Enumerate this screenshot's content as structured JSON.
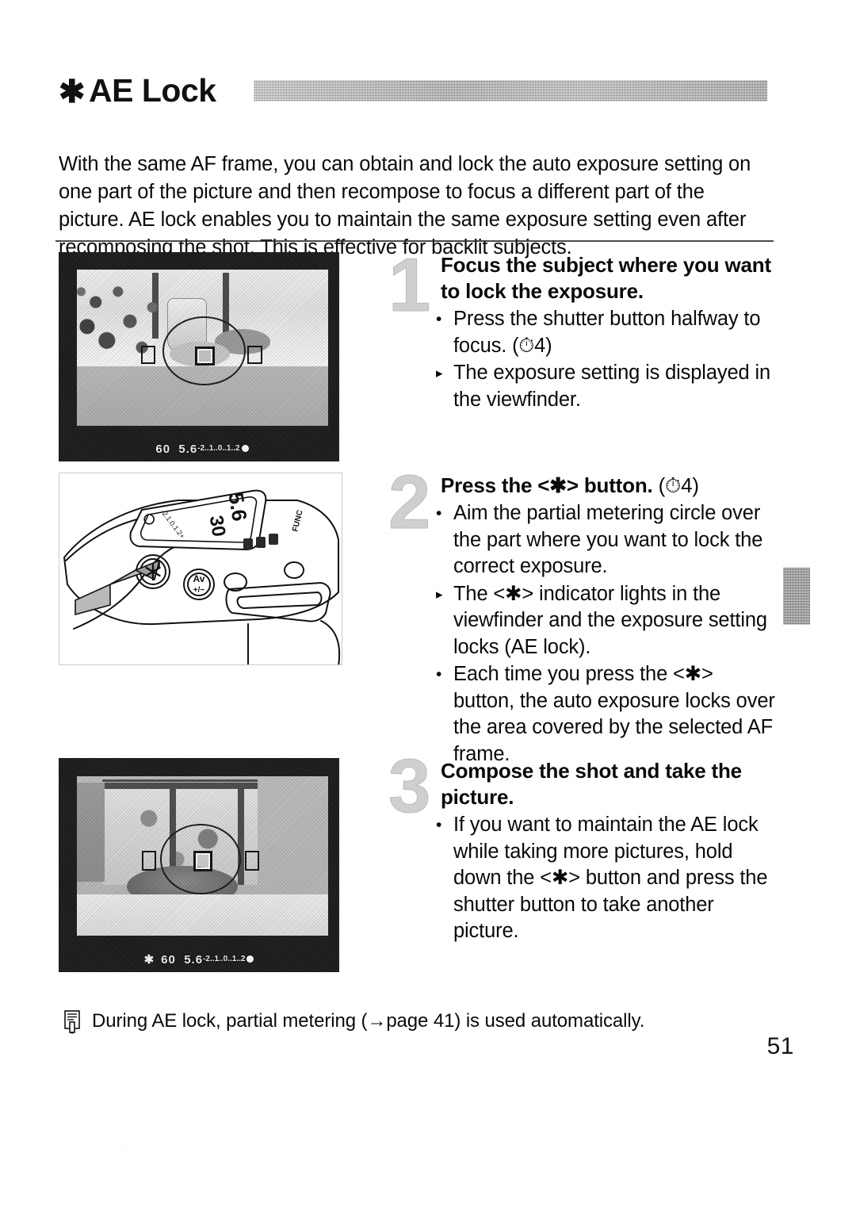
{
  "document": {
    "page_number": "51",
    "section_title": "AE Lock",
    "section_star_glyph": "✱"
  },
  "header": {
    "title": "AE Lock",
    "star": "✱"
  },
  "intro": {
    "text": "With the same AF frame, you can obtain and lock the auto exposure setting on one part of the picture and then recompose to focus a different part of the picture. AE lock enables you to maintain the same exposure setting even after recomposing the shot. This is effective for backlit subjects."
  },
  "steps": [
    {
      "number": "1",
      "heading": "Focus the subject where you want to lock the exposure.",
      "heading_suffix": "",
      "bullets": [
        {
          "mark": "•",
          "text": "Press the shutter button halfway to focus. (⏱4)"
        },
        {
          "mark": "▸",
          "text": "The exposure setting is displayed in the viewfinder."
        }
      ],
      "figure": {
        "name": "viewfinder-photo-focus",
        "type": "photo",
        "caption": "",
        "readout": {
          "star": "",
          "shutter": "60",
          "aperture": "5.6",
          "scale": "-2..1..0..1..2"
        }
      }
    },
    {
      "number": "2",
      "heading": "Press the <✱> button.",
      "heading_suffix": "(⏱4)",
      "bullets": [
        {
          "mark": "•",
          "text": "Aim the partial metering circle over the part where you want to lock the correct exposure."
        },
        {
          "mark": "▸",
          "text": "The <✱> indicator lights in the viewfinder and the exposure setting locks (AE lock)."
        },
        {
          "mark": "•",
          "text": "Each time you press the <✱> button, the auto exposure locks over the area covered by the selected AF frame."
        }
      ],
      "figure": {
        "name": "camera-ae-lock-button-illustration",
        "type": "line-drawing",
        "lcd": {
          "aperture": "5.6",
          "shutter": "30",
          "scale": "-2..1..0..1..2",
          "func_label": "FUNC"
        },
        "buttons": [
          {
            "label": "✱",
            "name": "ae-lock-button"
          },
          {
            "label": "Av +/−",
            "name": "av-exposure-compensation-button"
          }
        ]
      }
    },
    {
      "number": "3",
      "heading": "Compose the shot and take the picture.",
      "heading_suffix": "",
      "bullets": [
        {
          "mark": "•",
          "text": "If you want to maintain the AE lock while taking more pictures, hold down the <✱> button and press the shutter button to take another picture."
        }
      ],
      "figure": {
        "name": "viewfinder-photo-recomposed",
        "type": "photo",
        "caption": "",
        "readout": {
          "star": "✱",
          "shutter": "60",
          "aperture": "5.6",
          "scale": "-2..1..0..1..2"
        }
      }
    }
  ],
  "footnote": {
    "icon": "note-icon",
    "text": "During AE lock, partial metering (→page 41) is used automatically."
  },
  "colors": {
    "ink": "#0a0a0a",
    "step_number": "#cfcfcf",
    "header_bar": "#b6b6b6",
    "chapter_tab": "#9e9e9e",
    "paper": "#ffffff"
  }
}
